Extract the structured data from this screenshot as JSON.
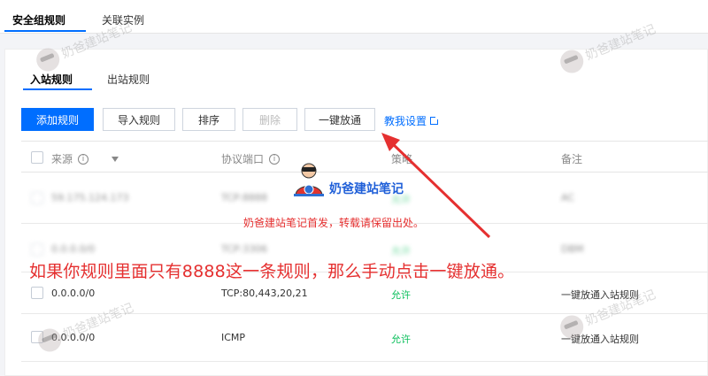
{
  "top_tabs": [
    {
      "label": "安全组规则"
    },
    {
      "label": "关联实例"
    }
  ],
  "sub_tabs": [
    {
      "label": "入站规则"
    },
    {
      "label": "出站规则"
    }
  ],
  "toolbar": {
    "add_label": "添加规则",
    "import_label": "导入规则",
    "sort_label": "排序",
    "delete_label": "删除",
    "one_click_label": "一键放通",
    "help_label": "教我设置"
  },
  "table": {
    "headers": {
      "source": "来源",
      "protocol": "协议端口",
      "policy": "策略",
      "note": "备注"
    },
    "rows": [
      {
        "source": "59.175.124.173",
        "protocol": "TCP:8888",
        "policy": "允许",
        "note": "AC"
      },
      {
        "source": "0.0.0.0/0",
        "protocol": "TCP:3306",
        "policy": "允许",
        "note": "DBM"
      },
      {
        "source": "0.0.0.0/0",
        "protocol": "TCP:80,443,20,21",
        "policy": "允许",
        "note": "一键放通入站规则"
      },
      {
        "source": "0.0.0.0/0",
        "protocol": "ICMP",
        "policy": "允许",
        "note": "一键放通入站规则"
      }
    ]
  },
  "annotations": {
    "watermark": "奶爸建站笔记",
    "logo_text": "奶爸建站笔记",
    "note_red": "奶爸建站笔记首发，转载请保留出处。",
    "big_red": "如果你规则里面只有8888这一条规则，那么手动点击一键放通。",
    "accent_color": "#006eff",
    "annotation_color": "#e53030",
    "allow_color": "#0abf5b"
  }
}
